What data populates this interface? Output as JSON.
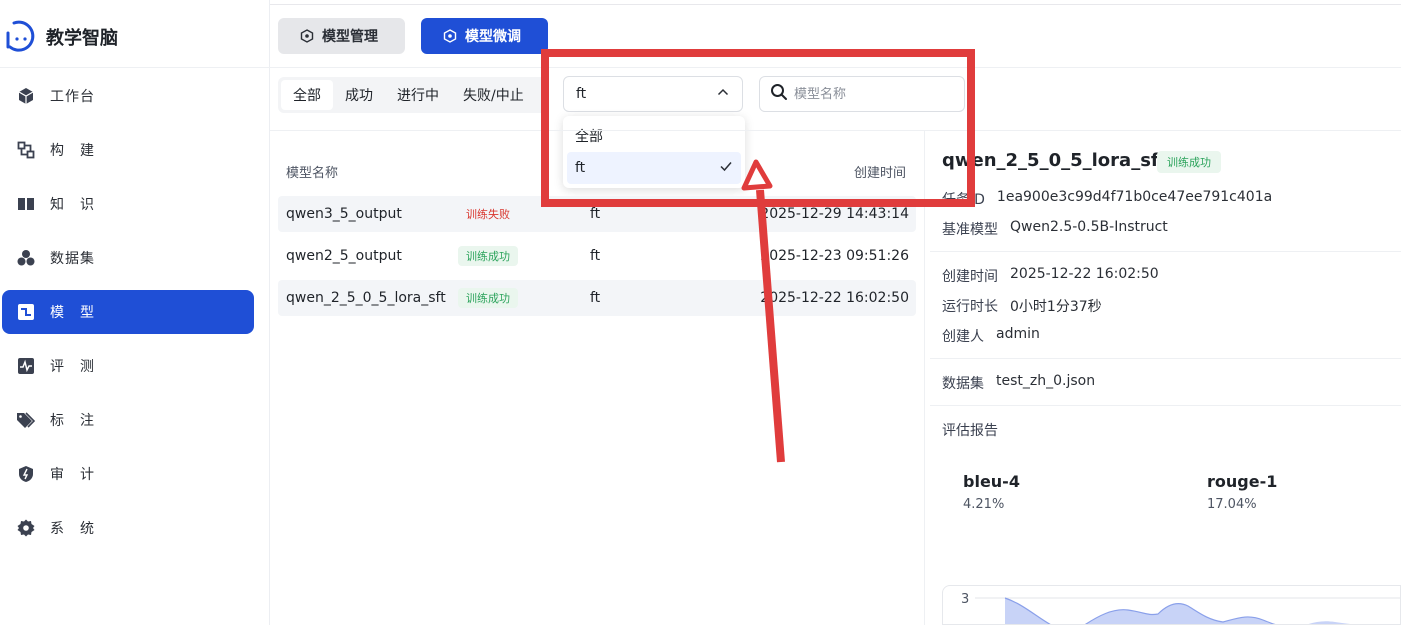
{
  "brand": {
    "title": "教学智脑"
  },
  "sidebar": {
    "items": [
      {
        "label": "工作台",
        "icon": "cube-icon"
      },
      {
        "label": "构　建",
        "icon": "build-icon"
      },
      {
        "label": "知　识",
        "icon": "book-icon"
      },
      {
        "label": "数据集",
        "icon": "dataset-icon"
      },
      {
        "label": "模　型",
        "icon": "model-icon",
        "active": true
      },
      {
        "label": "评　测",
        "icon": "pulse-icon"
      },
      {
        "label": "标　注",
        "icon": "tag-icon"
      },
      {
        "label": "审　计",
        "icon": "shield-icon"
      },
      {
        "label": "系　统",
        "icon": "gear-icon"
      }
    ]
  },
  "tabs": {
    "manage": "模型管理",
    "finetune": "模型微调"
  },
  "filters": {
    "status": [
      "全部",
      "成功",
      "进行中",
      "失败/中止"
    ],
    "type_value": "ft",
    "type_options": [
      "全部",
      "ft"
    ],
    "search_placeholder": "模型名称"
  },
  "table": {
    "headers": {
      "name": "模型名称",
      "created": "创建时间"
    },
    "rows": [
      {
        "name": "qwen3_5_output",
        "status": "训练失败",
        "status_kind": "fail",
        "type": "ft",
        "created": "2025-12-29 14:43:14"
      },
      {
        "name": "qwen2_5_output",
        "status": "训练成功",
        "status_kind": "ok",
        "type": "ft",
        "created": "2025-12-23 09:51:26"
      },
      {
        "name": "qwen_2_5_0_5_lora_sft",
        "status": "训练成功",
        "status_kind": "ok",
        "type": "ft",
        "created": "2025-12-22 16:02:50"
      }
    ]
  },
  "detail": {
    "title": "qwen_2_5_0_5_lora_sft",
    "status": "训练成功",
    "task_id_label": "任务ID",
    "task_id": "1ea900e3c99d4f71b0ce47ee791c401a",
    "base_model_label": "基准模型",
    "base_model": "Qwen2.5-0.5B-Instruct",
    "created_label": "创建时间",
    "created": "2025-12-22 16:02:50",
    "runtime_label": "运行时长",
    "runtime": "0小时1分37秒",
    "creator_label": "创建人",
    "creator": "admin",
    "dataset_label": "数据集",
    "dataset": "test_zh_0.json",
    "report_label": "评估报告",
    "metrics": [
      {
        "name": "bleu-4",
        "value": "4.21%"
      },
      {
        "name": "rouge-1",
        "value": "17.04%"
      }
    ],
    "chart_tick": "3"
  },
  "colors": {
    "accent": "#1f4fd6",
    "success": "#2ba35b",
    "fail": "#d9362e",
    "annotation": "#e03c3c"
  }
}
